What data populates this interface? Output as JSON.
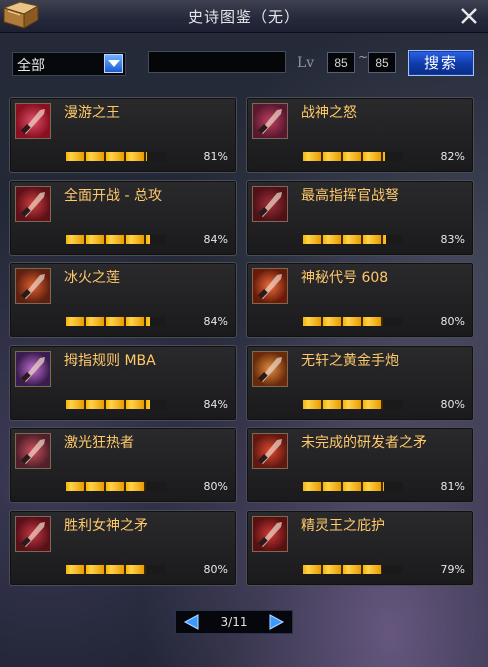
{
  "window": {
    "title": "史诗图鉴（无）"
  },
  "filters": {
    "category": "全部",
    "search_value": "",
    "lv_label": "Lv",
    "lv_min": "85",
    "lv_sep": "~",
    "lv_max": "85",
    "search_label": "搜索"
  },
  "items": [
    {
      "name": "漫游之王",
      "progress": 81,
      "pct": "81%",
      "icon": "dagger-icon",
      "colors": [
        "#8a1020",
        "#e0506a"
      ]
    },
    {
      "name": "战神之怒",
      "progress": 82,
      "pct": "82%",
      "icon": "battle-glove-icon",
      "colors": [
        "#5a1830",
        "#c04060"
      ]
    },
    {
      "name": "全面开战 - 总攻",
      "progress": 84,
      "pct": "84%",
      "icon": "cannon-icon",
      "colors": [
        "#601018",
        "#d04040"
      ]
    },
    {
      "name": "最高指挥官战弩",
      "progress": 83,
      "pct": "83%",
      "icon": "crossbow-icon",
      "colors": [
        "#501018",
        "#a03038"
      ]
    },
    {
      "name": "冰火之莲",
      "progress": 84,
      "pct": "84%",
      "icon": "spear-icon",
      "colors": [
        "#602010",
        "#e06030"
      ]
    },
    {
      "name": "神秘代号 608",
      "progress": 80,
      "pct": "80%",
      "icon": "rifle-icon",
      "colors": [
        "#6a1a08",
        "#f07040"
      ]
    },
    {
      "name": "拇指规则 MBA",
      "progress": 84,
      "pct": "84%",
      "icon": "glove-icon",
      "colors": [
        "#3a1c50",
        "#c070d0"
      ]
    },
    {
      "name": "无轩之黄金手炮",
      "progress": 80,
      "pct": "80%",
      "icon": "hand-cannon-icon",
      "colors": [
        "#6a2a0a",
        "#e09040"
      ]
    },
    {
      "name": "激光狂热者",
      "progress": 80,
      "pct": "80%",
      "icon": "laser-rifle-icon",
      "colors": [
        "#50202a",
        "#d05060"
      ]
    },
    {
      "name": "未完成的研发者之矛",
      "progress": 81,
      "pct": "81%",
      "icon": "lance-icon",
      "colors": [
        "#601810",
        "#e04a30"
      ]
    },
    {
      "name": "胜利女神之矛",
      "progress": 80,
      "pct": "80%",
      "icon": "trident-icon",
      "colors": [
        "#5a1018",
        "#c83848"
      ]
    },
    {
      "name": "精灵王之庇护",
      "progress": 79,
      "pct": "79%",
      "icon": "staff-icon",
      "colors": [
        "#5a1010",
        "#d03a3a"
      ]
    }
  ],
  "pagination": {
    "text": "3/11"
  }
}
